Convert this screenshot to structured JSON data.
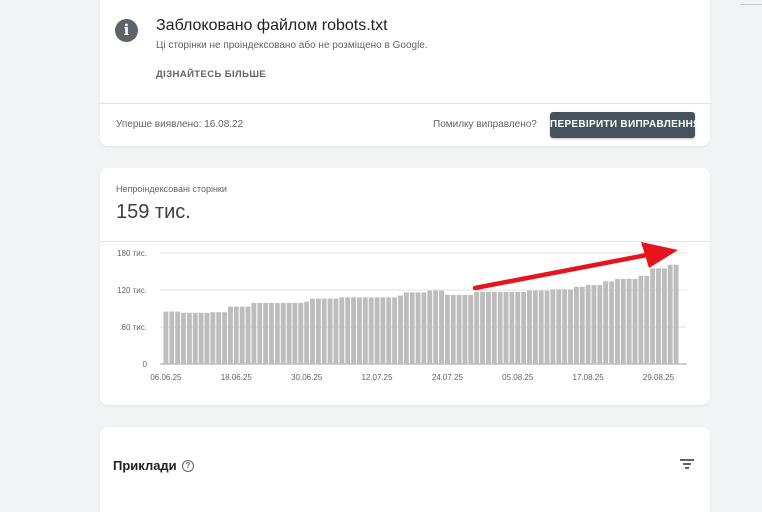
{
  "issue": {
    "info_icon": "info-icon",
    "title": "Заблоковано файлом robots.txt",
    "description": "Ці сторінки не проіндексовано або не розміщено в Google.",
    "learn_more": "ДІЗНАЙТЕСЬ БІЛЬШЕ",
    "first_detected": "Уперше виявлено: 16.08.22",
    "fixed_question": "Помилку виправлено?",
    "validate_button": "ПЕРЕВІРИТИ ВИПРАВЛЕННЯ",
    "validate_button_color": "#46535f"
  },
  "metric": {
    "label": "Непроіндексовані сторінки",
    "value": "159 тис."
  },
  "chart_data": {
    "type": "bar",
    "title": "",
    "xlabel": "",
    "ylabel": "",
    "bar_color": "#bdbdbd",
    "annotation": "red upward trend arrow",
    "annotation_color": "#e8141b",
    "grid": true,
    "ylim": [
      0,
      180
    ],
    "yticks": [
      {
        "value": 0,
        "label": "0"
      },
      {
        "value": 60,
        "label": "60 тис."
      },
      {
        "value": 120,
        "label": "120 тис."
      },
      {
        "value": 180,
        "label": "180 тис."
      }
    ],
    "x_tick_labels": [
      "06.06.25",
      "18.06.25",
      "30.06.25",
      "12.07.25",
      "24.07.25",
      "05.08.25",
      "17.08.25",
      "29.08.25"
    ],
    "categories": [
      "06.06.25",
      "07.06.25",
      "08.06.25",
      "09.06.25",
      "10.06.25",
      "11.06.25",
      "12.06.25",
      "13.06.25",
      "14.06.25",
      "15.06.25",
      "16.06.25",
      "17.06.25",
      "18.06.25",
      "19.06.25",
      "20.06.25",
      "21.06.25",
      "22.06.25",
      "23.06.25",
      "24.06.25",
      "25.06.25",
      "26.06.25",
      "27.06.25",
      "28.06.25",
      "29.06.25",
      "30.06.25",
      "01.07.25",
      "02.07.25",
      "03.07.25",
      "04.07.25",
      "05.07.25",
      "06.07.25",
      "07.07.25",
      "08.07.25",
      "09.07.25",
      "10.07.25",
      "11.07.25",
      "12.07.25",
      "13.07.25",
      "14.07.25",
      "15.07.25",
      "16.07.25",
      "17.07.25",
      "18.07.25",
      "19.07.25",
      "20.07.25",
      "21.07.25",
      "22.07.25",
      "23.07.25",
      "24.07.25",
      "25.07.25",
      "26.07.25",
      "27.07.25",
      "28.07.25",
      "29.07.25",
      "30.07.25",
      "31.07.25",
      "01.08.25",
      "02.08.25",
      "03.08.25",
      "04.08.25",
      "05.08.25",
      "06.08.25",
      "07.08.25",
      "08.08.25",
      "09.08.25",
      "10.08.25",
      "11.08.25",
      "12.08.25",
      "13.08.25",
      "14.08.25",
      "15.08.25",
      "16.08.25",
      "17.08.25",
      "18.08.25",
      "19.08.25",
      "20.08.25",
      "21.08.25",
      "22.08.25",
      "23.08.25",
      "24.08.25",
      "25.08.25",
      "26.08.25",
      "27.08.25",
      "28.08.25",
      "29.08.25",
      "30.08.25",
      "31.08.25",
      "01.09.25"
    ],
    "values": [
      85,
      85,
      85,
      83,
      83,
      83,
      83,
      83,
      84,
      84,
      84,
      93,
      93,
      93,
      93,
      99,
      99,
      99,
      99,
      99,
      99,
      99,
      99,
      99,
      101,
      106,
      106,
      106,
      106,
      106,
      108,
      108,
      108,
      108,
      108,
      108,
      108,
      108,
      108,
      108,
      111,
      116,
      116,
      116,
      116,
      119,
      119,
      119,
      112,
      112,
      112,
      112,
      112,
      117,
      117,
      117,
      117,
      117,
      117,
      117,
      117,
      117,
      119,
      119,
      119,
      119,
      121,
      121,
      121,
      121,
      125,
      125,
      128,
      128,
      128,
      134,
      134,
      138,
      138,
      138,
      138,
      143,
      143,
      155,
      155,
      155,
      161,
      161
    ]
  },
  "examples": {
    "title": "Приклади",
    "help_icon": "help-icon",
    "filter_icon": "filter-icon"
  }
}
